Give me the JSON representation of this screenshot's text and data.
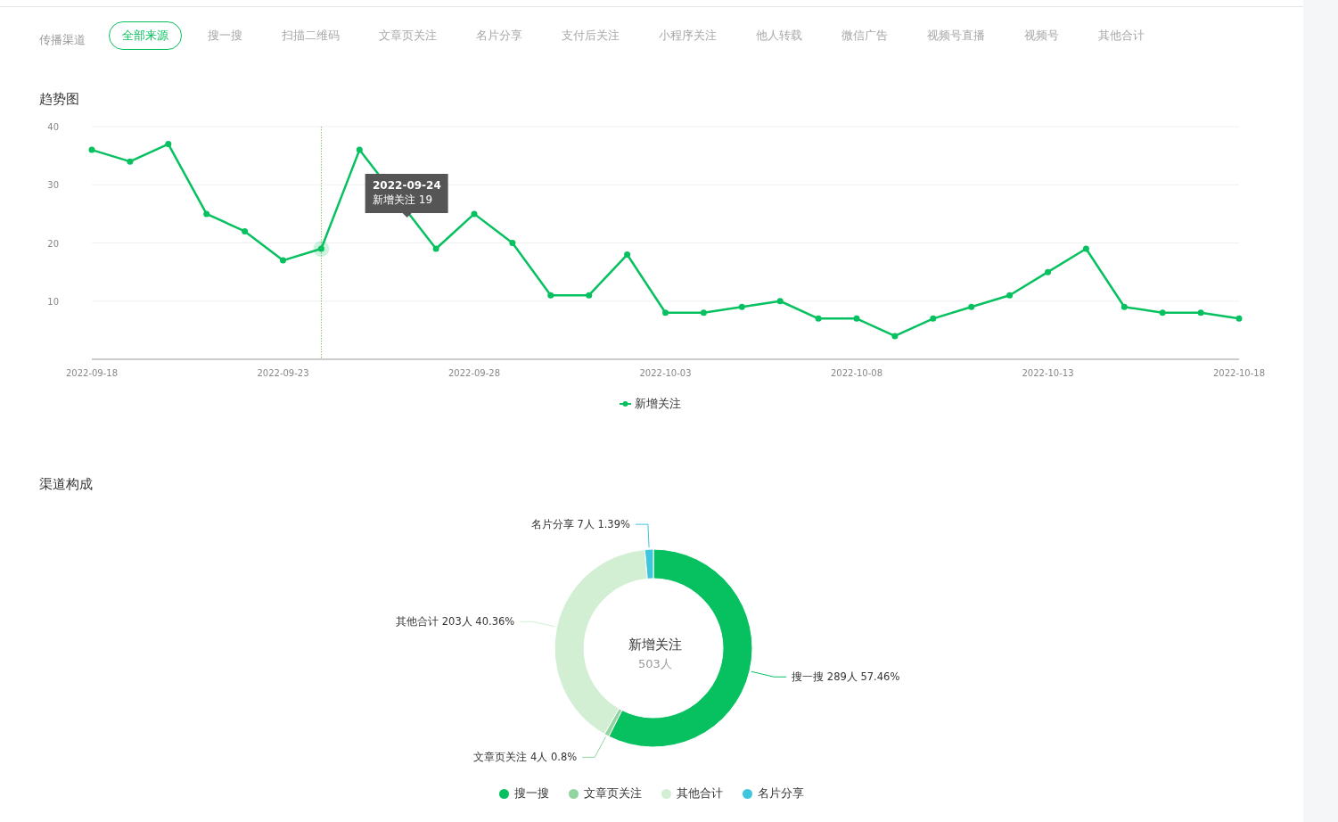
{
  "filter": {
    "label": "传播渠道",
    "tabs": [
      {
        "label": "全部来源",
        "selected": true
      },
      {
        "label": "搜一搜",
        "selected": false
      },
      {
        "label": "扫描二维码",
        "selected": false
      },
      {
        "label": "文章页关注",
        "selected": false
      },
      {
        "label": "名片分享",
        "selected": false
      },
      {
        "label": "支付后关注",
        "selected": false
      },
      {
        "label": "小程序关注",
        "selected": false
      },
      {
        "label": "他人转载",
        "selected": false
      },
      {
        "label": "微信广告",
        "selected": false
      },
      {
        "label": "视频号直播",
        "selected": false
      },
      {
        "label": "视频号",
        "selected": false
      },
      {
        "label": "其他合计",
        "selected": false
      }
    ]
  },
  "trend": {
    "title": "趋势图",
    "chart_data": {
      "type": "line",
      "x": [
        "2022-09-18",
        "2022-09-19",
        "2022-09-20",
        "2022-09-21",
        "2022-09-22",
        "2022-09-23",
        "2022-09-24",
        "2022-09-25",
        "2022-09-26",
        "2022-09-27",
        "2022-09-28",
        "2022-09-29",
        "2022-09-30",
        "2022-10-01",
        "2022-10-02",
        "2022-10-03",
        "2022-10-04",
        "2022-10-05",
        "2022-10-06",
        "2022-10-07",
        "2022-10-08",
        "2022-10-09",
        "2022-10-10",
        "2022-10-11",
        "2022-10-12",
        "2022-10-13",
        "2022-10-14",
        "2022-10-15",
        "2022-10-16",
        "2022-10-17",
        "2022-10-18"
      ],
      "series": [
        {
          "name": "新增关注",
          "color": "#07c160",
          "marker": "circle",
          "values": [
            36,
            34,
            37,
            25,
            22,
            17,
            19,
            36,
            null,
            19,
            25,
            20,
            11,
            11,
            18,
            8,
            8,
            9,
            10,
            7,
            7,
            4,
            7,
            9,
            11,
            15,
            19,
            9,
            8,
            8,
            7
          ]
        }
      ],
      "xlim": [
        "2022-09-18",
        "2022-10-18"
      ],
      "ylim": [
        0,
        40
      ],
      "yticks": [
        10,
        20,
        30,
        40
      ],
      "grid": true,
      "legend": "bottom",
      "xticks": [
        "2022-09-18",
        "2022-09-23",
        "2022-09-28",
        "2022-10-03",
        "2022-10-08",
        "2022-10-13",
        "2022-10-18"
      ],
      "ref_lines": [
        {
          "axis": "x",
          "value": "2022-09-24"
        }
      ]
    },
    "tooltip": {
      "title": "2022-09-24",
      "text": "新增关注 19"
    }
  },
  "composition": {
    "title": "渠道构成",
    "chart_data": {
      "type": "donut",
      "title": "新增关注",
      "legend": "bottom",
      "categories": [
        "搜一搜",
        "文章页关注",
        "其他合计",
        "名片分享"
      ],
      "values": [
        57.46,
        0.8,
        40.36,
        1.39
      ],
      "colors": [
        "#07c160",
        "#91d5a0",
        "#d2efd4",
        "#3ec6dc"
      ],
      "value_labels": [
        "搜一搜 289人 57.46%",
        "文章页关注 4人 0.8%",
        "其他合计 203人 40.36%",
        "名片分享 7人 1.39%"
      ]
    },
    "center_value": "503人"
  }
}
